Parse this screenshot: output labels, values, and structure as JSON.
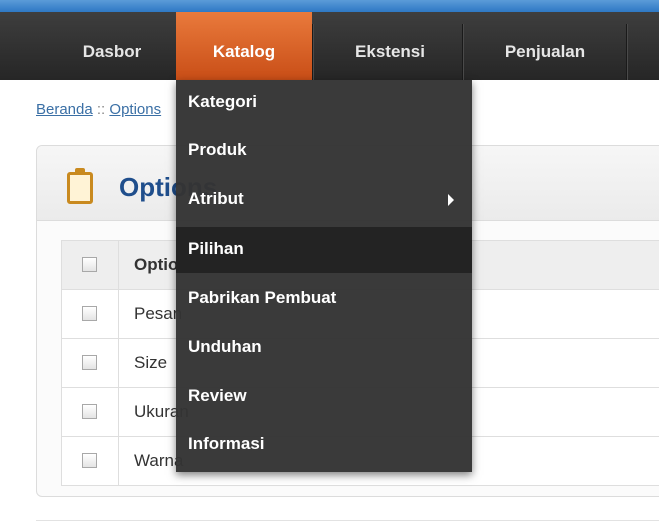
{
  "nav": {
    "items": [
      "Dasbor",
      "Katalog",
      "Ekstensi",
      "Penjualan"
    ],
    "active": "Katalog"
  },
  "breadcrumb": {
    "home": "Beranda",
    "separator": "::",
    "current": "Options"
  },
  "panel": {
    "title": "Options",
    "icon": "clipboard-icon"
  },
  "table": {
    "header": "Option Name",
    "rows": [
      "Pesan",
      "Size",
      "Ukuran",
      "Warna"
    ]
  },
  "dropdown": {
    "items": [
      {
        "label": "Kategori"
      },
      {
        "label": "Produk"
      },
      {
        "label": "Atribut",
        "has_submenu": true
      },
      {
        "label": "Pilihan",
        "highlighted": true
      },
      {
        "label": "Pabrikan Pembuat"
      },
      {
        "label": "Unduhan"
      },
      {
        "label": "Review"
      },
      {
        "label": "Informasi"
      }
    ]
  },
  "colors": {
    "active_tab": "#d85f22",
    "navbar": "#2e2e2e",
    "title": "#1f4e8c",
    "link": "#3a6fa5"
  }
}
